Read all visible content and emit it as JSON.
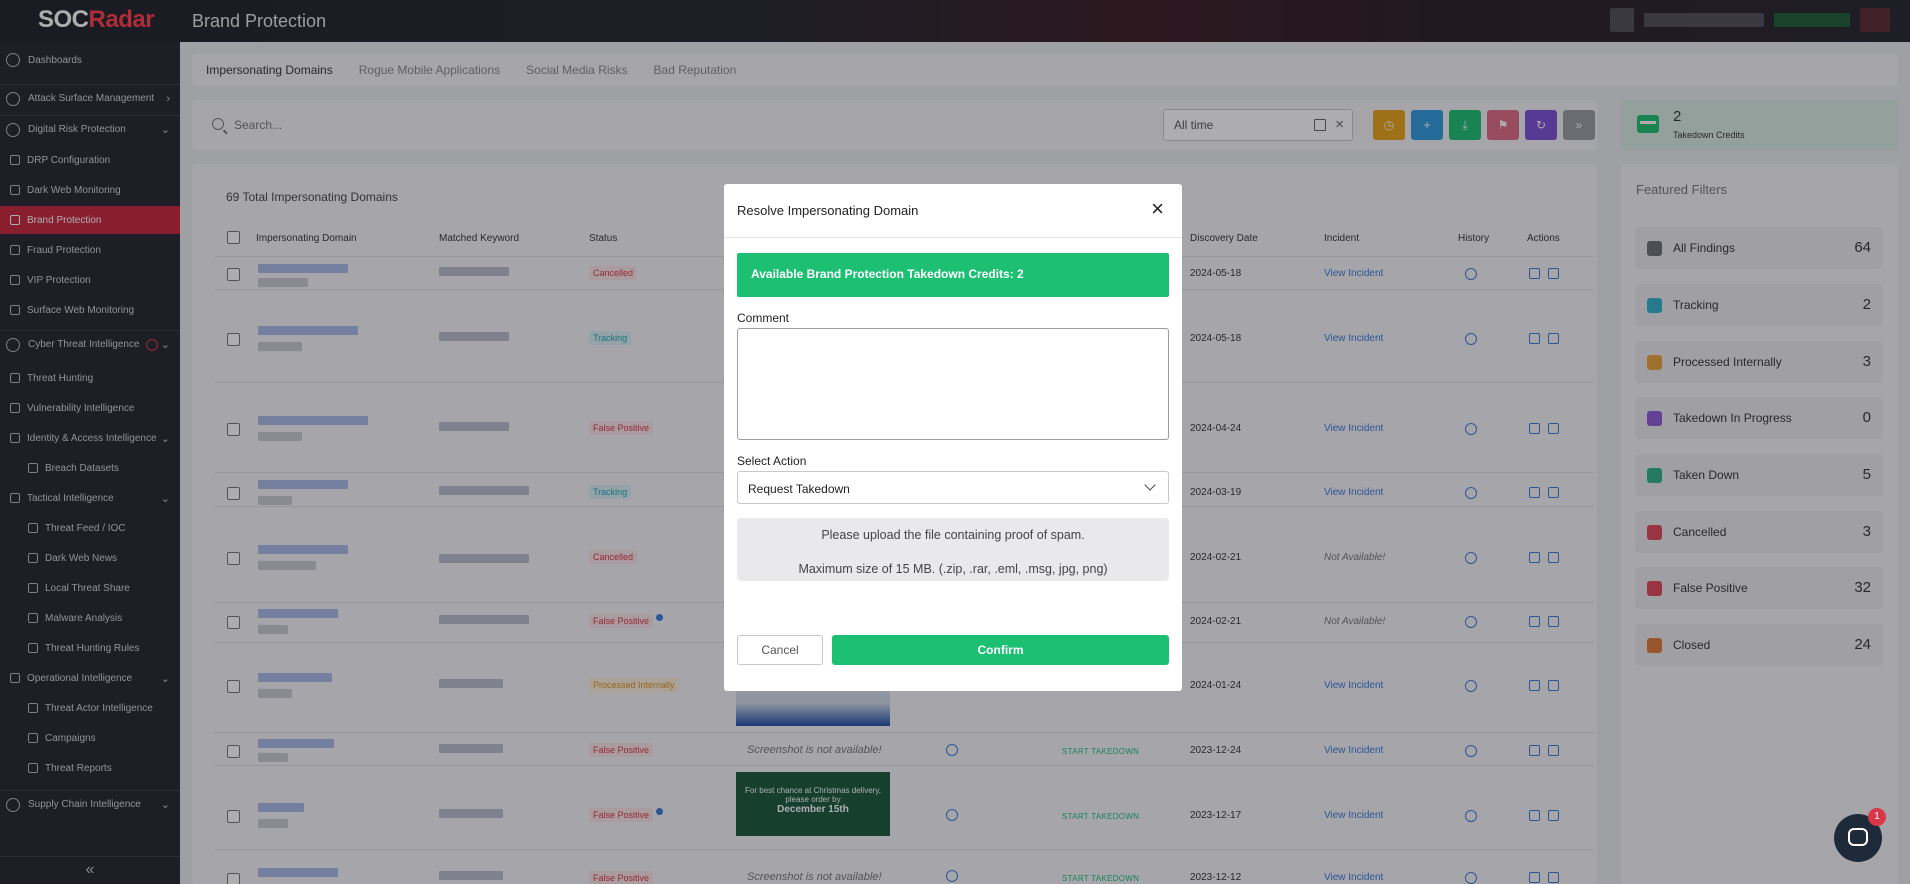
{
  "app": {
    "logo_prefix": "SOC",
    "logo_suffix": "Radar",
    "page_title": "Brand Protection"
  },
  "sidebar": {
    "items": [
      {
        "label": "Dashboards"
      },
      {
        "label": "Attack Surface Management"
      },
      {
        "label": "Digital Risk Protection"
      },
      {
        "label": "DRP Configuration"
      },
      {
        "label": "Dark Web Monitoring"
      },
      {
        "label": "Brand Protection"
      },
      {
        "label": "Fraud Protection"
      },
      {
        "label": "VIP Protection"
      },
      {
        "label": "Surface Web Monitoring"
      },
      {
        "label": "Cyber Threat Intelligence"
      },
      {
        "label": "Threat Hunting"
      },
      {
        "label": "Vulnerability Intelligence"
      },
      {
        "label": "Identity & Access Intelligence"
      },
      {
        "label": "Breach Datasets"
      },
      {
        "label": "Tactical Intelligence"
      },
      {
        "label": "Threat Feed / IOC"
      },
      {
        "label": "Dark Web News"
      },
      {
        "label": "Local Threat Share"
      },
      {
        "label": "Malware Analysis"
      },
      {
        "label": "Threat Hunting Rules"
      },
      {
        "label": "Operational Intelligence"
      },
      {
        "label": "Threat Actor Intelligence"
      },
      {
        "label": "Campaigns"
      },
      {
        "label": "Threat Reports"
      },
      {
        "label": "Supply Chain Intelligence"
      }
    ],
    "collapse": "«"
  },
  "tabs": [
    "Impersonating Domains",
    "Rogue Mobile Applications",
    "Social Media Risks",
    "Bad Reputation"
  ],
  "search": {
    "placeholder": "Search..."
  },
  "date_filter": {
    "value": "All time",
    "clear": "×"
  },
  "toolbar_colors": [
    "#e8a317",
    "#2f9be0",
    "#1dbf73",
    "#e06a84",
    "#7b4fd6",
    "#9a9ba0"
  ],
  "credits": {
    "count": "2",
    "label": "Takedown Credits"
  },
  "table": {
    "total": "69 Total Impersonating Domains",
    "headers": [
      "Impersonating Domain",
      "Matched Keyword",
      "Status",
      "Discovery Date",
      "Incident",
      "History",
      "Actions"
    ],
    "rows": [
      {
        "status": "Cancelled",
        "date": "2024-05-18",
        "incident": "View Incident"
      },
      {
        "status": "Tracking",
        "date": "2024-05-18",
        "incident": "View Incident"
      },
      {
        "status": "False Positive",
        "date": "2024-04-24",
        "incident": "View Incident"
      },
      {
        "status": "Tracking",
        "date": "2024-03-19",
        "incident": "View Incident"
      },
      {
        "status": "Cancelled",
        "date": "2024-02-21",
        "incident": "Not Available!"
      },
      {
        "status": "False Positive",
        "date": "2024-02-21",
        "incident": "Not Available!"
      },
      {
        "status": "Processed Internally",
        "date": "2024-01-24",
        "incident": "View Incident"
      },
      {
        "status": "False Positive",
        "date": "2023-12-24",
        "incident": "View Incident",
        "screenshot": "Screenshot is not available!",
        "takedown": "START TAKEDOWN"
      },
      {
        "status": "False Positive",
        "date": "2023-12-17",
        "incident": "View Incident",
        "takedown": "START TAKEDOWN"
      },
      {
        "status": "False Positive",
        "date": "2023-12-12",
        "incident": "View Incident",
        "screenshot": "Screenshot is not available!",
        "takedown": "START TAKEDOWN"
      }
    ],
    "ad_text": {
      "line1": "For best chance at Christmas delivery,",
      "line2": "please order by",
      "line3": "December 15th"
    }
  },
  "filters": {
    "title": "Featured Filters",
    "items": [
      {
        "label": "All Findings",
        "count": "64",
        "color": "#6c6d73"
      },
      {
        "label": "Tracking",
        "count": "2",
        "color": "#2fb3c8"
      },
      {
        "label": "Processed Internally",
        "count": "3",
        "color": "#e8a33a"
      },
      {
        "label": "Takedown In Progress",
        "count": "0",
        "color": "#8c5ad6"
      },
      {
        "label": "Taken Down",
        "count": "5",
        "color": "#2db389"
      },
      {
        "label": "Cancelled",
        "count": "3",
        "color": "#e0485a"
      },
      {
        "label": "False Positive",
        "count": "32",
        "color": "#e0485a"
      },
      {
        "label": "Closed",
        "count": "24",
        "color": "#e07a3a"
      }
    ]
  },
  "modal": {
    "title": "Resolve Impersonating Domain",
    "close": "×",
    "credits_banner": "Available Brand Protection Takedown Credits: 2",
    "comment_label": "Comment",
    "comment_value": "",
    "action_label": "Select Action",
    "action_value": "Request Takedown",
    "upload_line1": "Please upload the file containing proof of spam.",
    "upload_line2": "Maximum size of 15 MB. (.zip, .rar, .eml, .msg, jpg, png)",
    "cancel": "Cancel",
    "confirm": "Confirm"
  },
  "chat": {
    "badge": "1"
  }
}
